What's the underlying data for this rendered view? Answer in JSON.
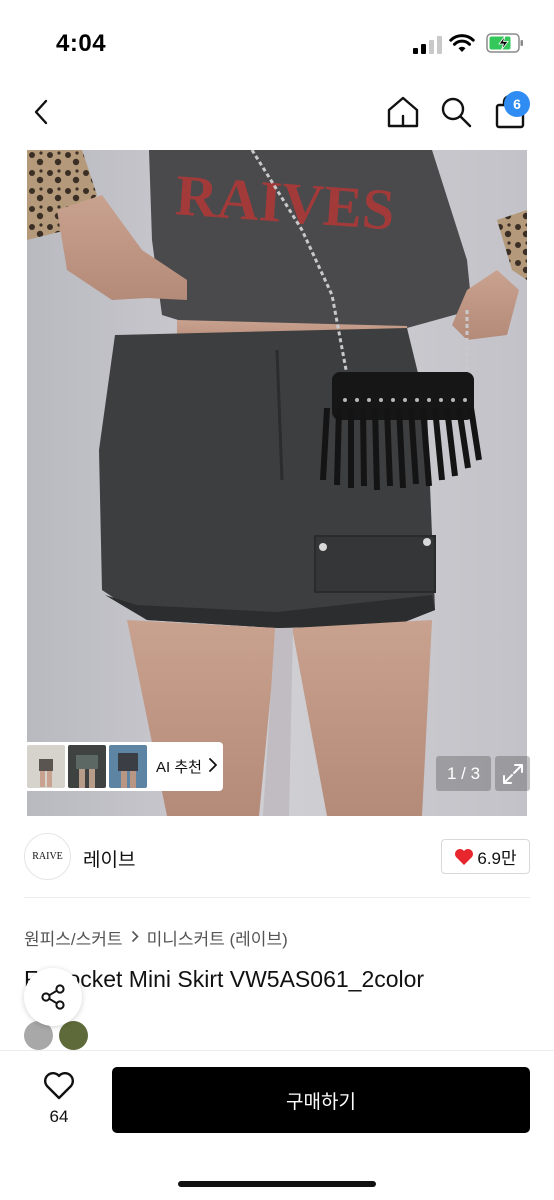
{
  "status_bar": {
    "time": "4:04"
  },
  "nav": {
    "cart_badge": "6",
    "icons": [
      "chevron-left-icon",
      "home-icon",
      "search-icon",
      "shopping-bag-icon"
    ]
  },
  "hero": {
    "shirt_print": "RAIVES",
    "ai_recommend_label": "AI 추천",
    "pager": "1 / 3"
  },
  "brand": {
    "logo_text": "RAIVE",
    "name": "레이브",
    "likes": "6.9만"
  },
  "breadcrumb": {
    "category": "원피스/스커트",
    "subcategory": "미니스커트 (레이브)"
  },
  "product": {
    "title": "F   -Pocket Mini Skirt VW5AS061_2color",
    "swatch_colors": [
      "#a8a8a8",
      "#5f6a3a"
    ]
  },
  "bottom_bar": {
    "wish_count": "64",
    "buy_label": "구매하기"
  },
  "colors": {
    "accent_badge": "#2f8cf3",
    "heart_red": "#e8262e",
    "buy_button": "#000000"
  }
}
